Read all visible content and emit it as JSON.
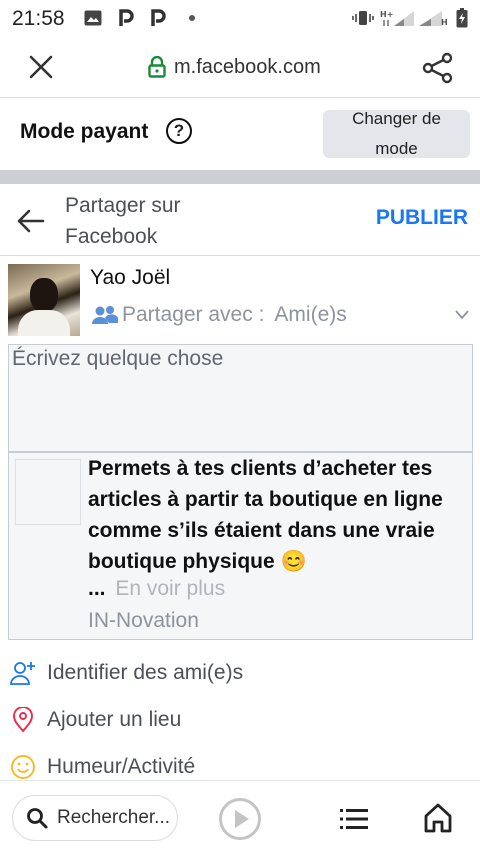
{
  "status_bar": {
    "time": "21:58",
    "icons": [
      "image-icon",
      "p-icon",
      "p-icon",
      "dot-icon",
      "vibrate-icon",
      "signal-h-plus-icon",
      "signal-h-icon",
      "battery-icon"
    ]
  },
  "browser": {
    "url": "m.facebook.com",
    "close_icon": "close-icon",
    "lock_icon": "lock-icon",
    "share_icon": "share-icon"
  },
  "mode": {
    "label": "Mode payant",
    "help": "?",
    "change_button": "Changer de mode"
  },
  "share_header": {
    "title": "Partager sur Facebook",
    "publish": "PUBLIER"
  },
  "user": {
    "name": "Yao Joël",
    "share_with_label": "Partager avec :",
    "share_with_value": "Ami(e)s"
  },
  "compose": {
    "placeholder": "Écrivez quelque chose"
  },
  "card": {
    "title": "Permets à tes clients d’acheter tes articles à partir ta boutique en ligne comme s’ils étaient dans une vraie boutique physique 😊",
    "ellipsis": "...",
    "see_more": "En voir plus",
    "site": "IN-Novation"
  },
  "actions": [
    {
      "label": "Identifier des ami(e)s",
      "icon": "tag-friends-icon",
      "color": "#1877f2"
    },
    {
      "label": "Ajouter un lieu",
      "icon": "location-pin-icon",
      "color": "#f02849"
    },
    {
      "label": "Humeur/Activité",
      "icon": "smiley-icon",
      "color": "#f7b928"
    }
  ],
  "bottom": {
    "search_text": "Rechercher..."
  },
  "colors": {
    "accent": "#1877f2",
    "separator": "#ccd0d5"
  }
}
